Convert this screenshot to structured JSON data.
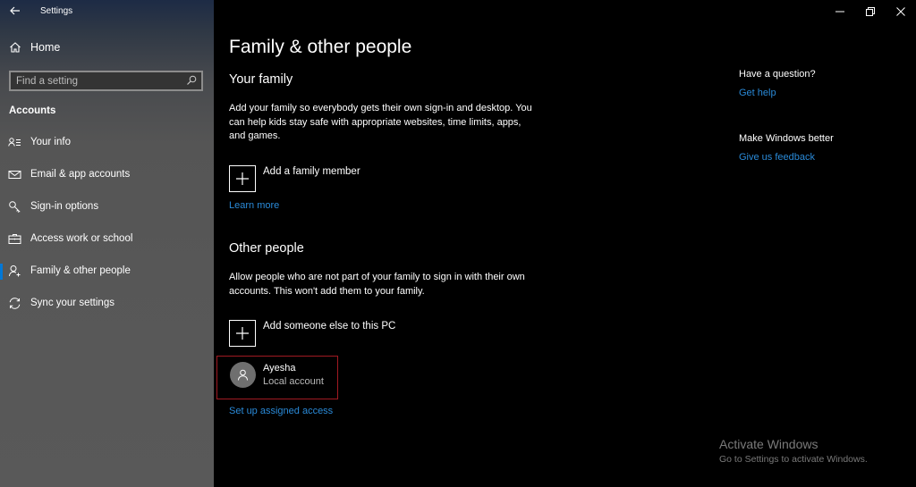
{
  "app": {
    "title": "Settings"
  },
  "sidebar": {
    "home_label": "Home",
    "search": {
      "placeholder": "Find a setting",
      "value": ""
    },
    "section_title": "Accounts",
    "items": [
      {
        "label": "Your info",
        "icon": "person-list-icon",
        "active": false
      },
      {
        "label": "Email & app accounts",
        "icon": "mail-icon",
        "active": false
      },
      {
        "label": "Sign-in options",
        "icon": "key-icon",
        "active": false
      },
      {
        "label": "Access work or school",
        "icon": "briefcase-icon",
        "active": false
      },
      {
        "label": "Family & other people",
        "icon": "person-add-icon",
        "active": true
      },
      {
        "label": "Sync your settings",
        "icon": "sync-icon",
        "active": false
      }
    ],
    "accent_color": "#0078d7"
  },
  "main": {
    "title": "Family & other people",
    "your_family": {
      "heading": "Your family",
      "description": "Add your family so everybody gets their own sign-in and desktop. You can help kids stay safe with appropriate websites, time limits, apps, and games.",
      "add_label": "Add a family member",
      "link": "Learn more"
    },
    "other_people": {
      "heading": "Other people",
      "description": "Allow people who are not part of your family to sign in with their own accounts. This won't add them to your family.",
      "add_label": "Add someone else to this PC",
      "users": [
        {
          "name": "Ayesha",
          "type": "Local account"
        }
      ],
      "link": "Set up assigned access"
    }
  },
  "aside": {
    "question_heading": "Have a question?",
    "help_link": "Get help",
    "feedback_heading": "Make Windows better",
    "feedback_link": "Give us feedback"
  },
  "watermark": {
    "title": "Activate Windows",
    "subtitle": "Go to Settings to activate Windows."
  },
  "colors": {
    "link": "#2a8ad8",
    "highlight_border": "#a11a22"
  }
}
